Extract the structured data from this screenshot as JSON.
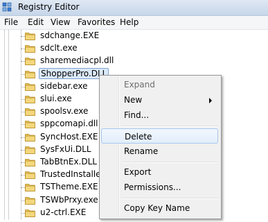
{
  "window": {
    "title": "Registry Editor"
  },
  "menubar": {
    "items": [
      "File",
      "Edit",
      "View",
      "Favorites",
      "Help"
    ]
  },
  "tree": {
    "items": [
      "sdchange.EXE",
      "sdclt.exe",
      "sharemediacpl.dll",
      "ShopperPro.DLL",
      "sidebar.exe",
      "slui.exe",
      "spoolsv.exe",
      "sppcomapi.dll",
      "SyncHost.EXE",
      "SysFxUi.DLL",
      "TabBtnEx.DLL",
      "TrustedInstaller.e",
      "TSTheme.EXE",
      "TSWbPrxy.exe",
      "u2-ctrl.EXE"
    ],
    "selected": "ShopperPro.DLL"
  },
  "context_menu": {
    "expand": "Expand",
    "new": "New",
    "find": "Find...",
    "delete": "Delete",
    "rename": "Rename",
    "export": "Export",
    "permissions": "Permissions...",
    "copy_key_name": "Copy Key Name"
  },
  "colors": {
    "selection": "#dbe9f8",
    "folder": "#e8c15a",
    "menu_bg": "#f0f0f0"
  }
}
